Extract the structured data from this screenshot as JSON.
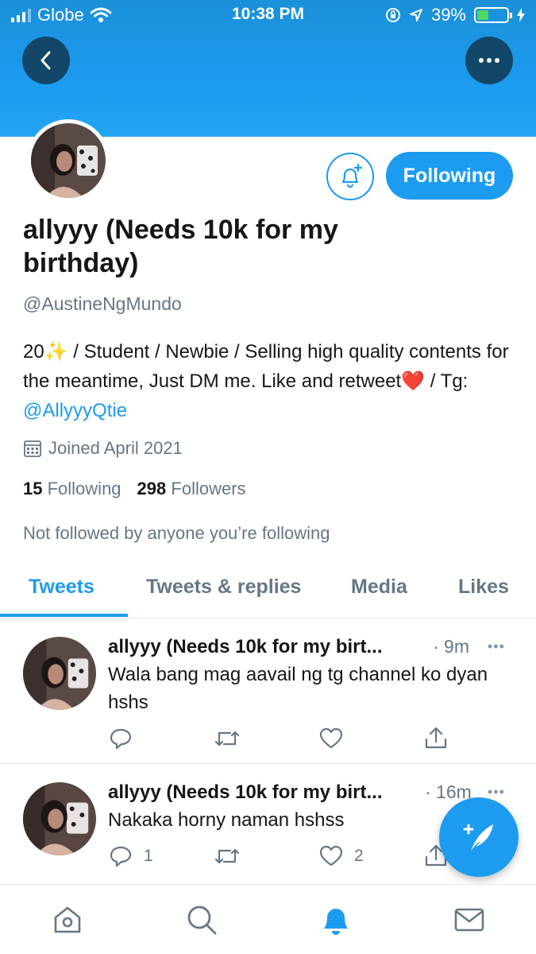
{
  "status_bar": {
    "carrier": "Globe",
    "time": "10:38 PM",
    "battery_percent": "39%",
    "battery_level": 0.39
  },
  "profile": {
    "display_name": "allyyy (Needs 10k for my birthday)",
    "handle": "@AustineNgMundo",
    "bio_prefix": "20",
    "bio_sparkle": "✨",
    "bio_middle": " / Student / Newbie / Selling high quality contents for the meantime, Just DM me. Like and retweet",
    "bio_heart": "❤️",
    "bio_tg": " / Tg: ",
    "bio_mention": "@AllyyyQtie",
    "joined": "Joined April 2021",
    "following_count": "15",
    "following_label": "Following",
    "followers_count": "298",
    "followers_label": "Followers",
    "not_followed": "Not followed by anyone you’re following",
    "following_button": "Following"
  },
  "tabs": [
    {
      "label": "Tweets",
      "active": true
    },
    {
      "label": "Tweets & replies",
      "active": false
    },
    {
      "label": "Media",
      "active": false
    },
    {
      "label": "Likes",
      "active": false
    }
  ],
  "tweets": [
    {
      "name": "allyyy (Needs 10k for my birt...",
      "time": "· 9m",
      "more": "•••",
      "text": "Wala bang mag aavail ng tg channel ko dyan hshs",
      "replies": "",
      "likes": ""
    },
    {
      "name": "allyyy (Needs 10k for my birt...",
      "time": "· 16m",
      "more": "•••",
      "text": "Nakaka horny naman hshss",
      "replies": "1",
      "likes": "2"
    }
  ],
  "colors": {
    "accent": "#1d9bf0",
    "banner": "#1d9bf0",
    "muted": "#657786"
  },
  "icons": [
    "back-arrow-icon",
    "more-icon",
    "bell-plus-icon",
    "calendar-icon",
    "reply-icon",
    "retweet-icon",
    "like-icon",
    "share-icon",
    "compose-icon",
    "home-icon",
    "search-icon",
    "notifications-icon",
    "messages-icon"
  ]
}
